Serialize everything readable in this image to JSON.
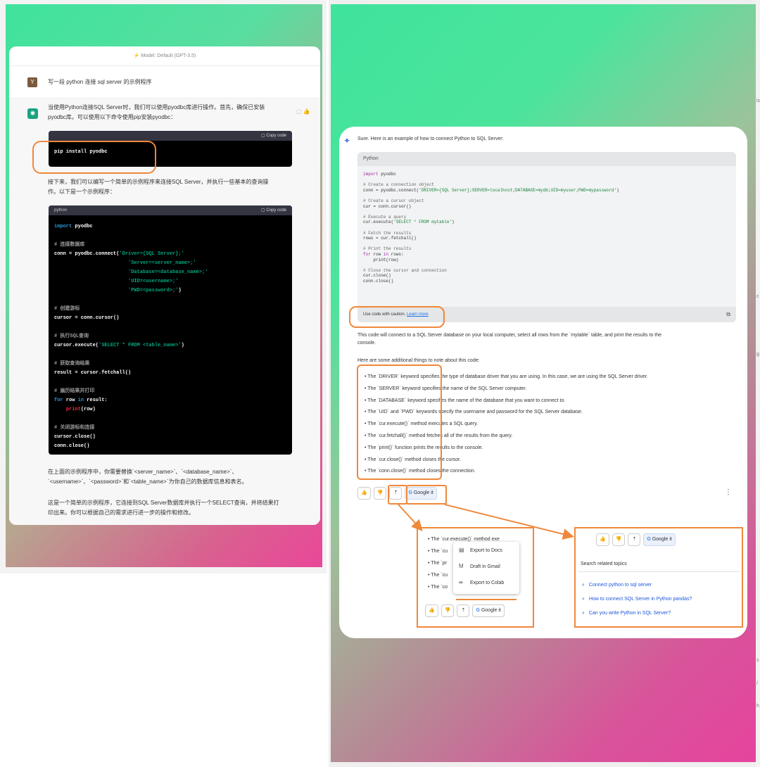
{
  "left": {
    "model_label": "⚡ Model: Default (GPT-3.5)",
    "user_avatar": "Y",
    "user_message": "写一段 python 连接 sql server 的示例程序",
    "assistant_p1_line1": "当使用Python连接SQL Server时，我们可以使用pyodbc库进行操作。首先，确保已安装",
    "assistant_p1_line2": "pyodbc库。可以使用以下命令使用pip安装pyodbc：",
    "copy_label": "Copy code",
    "code1_lang": "",
    "code1": "pip install pyodbc",
    "assistant_p2_line1": "接下来，我们可以编写一个简单的示例程序来连接SQL Server，并执行一些基本的查询操",
    "assistant_p2_line2": "作。以下是一个示例程序：",
    "code2_lang": "python",
    "code2_lines": {
      "l1_kw": "import",
      "l1_rest": " pyodbc",
      "l2": "# 连接数据库",
      "l3_a": "conn = pyodbc.connect(",
      "l3_s": "'Driver={SQL Server};'",
      "l4": "'Server=<server_name>;'",
      "l5": "'Database=<database_name>;'",
      "l6": "'UID=<username>;'",
      "l7_s": "'PWD=<password>;'",
      "l7_e": ")",
      "l8": "# 创建游标",
      "l9": "cursor = conn.cursor()",
      "l10": "# 执行SQL查询",
      "l11_a": "cursor.execute(",
      "l11_s": "'SELECT * FROM <table_name>'",
      "l11_e": ")",
      "l12": "# 获取查询结果",
      "l13": "result = cursor.fetchall()",
      "l14": "# 遍历结果并打印",
      "l15_k1": "for",
      "l15_a": " row ",
      "l15_k2": "in",
      "l15_b": " result:",
      "l16_f": "print",
      "l16_e": "(row)",
      "l17": "# 关闭游标和连接",
      "l18": "cursor.close()",
      "l19": "conn.close()"
    },
    "assistant_p3_line1": "在上面的示例程序中，你需要替换`<server_name>`、`<database_name>`、",
    "assistant_p3_line2": "`<username>`、`<password>`和`<table_name>`为你自己的数据库信息和表名。",
    "assistant_p4_line1": "这是一个简单的示例程序，它连接到SQL Server数据库并执行一个SELECT查询，并将结果打",
    "assistant_p4_line2": "印出来。你可以根据自己的需求进行进一步的操作和修改。"
  },
  "right": {
    "intro": "Sure. Here is an example of how to connect Python to SQL Server:",
    "code_lang": "Python",
    "code": {
      "c1_kw": "import",
      "c1_rest": " pyodbc",
      "c2": "# Create a connection object",
      "c3_a": "conn = pyodbc.connect(",
      "c3_s": "'DRIVER={SQL Server};SERVER=localhost;DATABASE=mydb;UID=myuser;PWD=mypassword'",
      "c3_e": ")",
      "c4": "# Create a cursor object",
      "c5": "cur = conn.cursor()",
      "c6": "# Execute a query",
      "c7_a": "cur.execute(",
      "c7_s": "'SELECT * FROM mytable'",
      "c7_e": ")",
      "c8": "# Fetch the results",
      "c9": "rows = cur.fetchall()",
      "c10": "# Print the results",
      "c11_k1": "for",
      "c11_a": " row ",
      "c11_k2": "in",
      "c11_b": " rows:",
      "c12": "    print(row)",
      "c13": "# Close the cursor and connection",
      "c14": "cur.close()",
      "c15": "conn.close()"
    },
    "caution_text": "Use code with caution. ",
    "learn_more": "Learn more",
    "summary_line1": "This code will connect to a SQL Server database on your local computer, select all rows from the `mytable` table, and print the results to the",
    "summary_line2": "console.",
    "notes_heading": "Here are some additional things to note about this code:",
    "bullets": [
      "The `DRIVER` keyword specifies the type of database driver that you are using. In this case, we are using the SQL Server driver.",
      "The `SERVER` keyword specifies the name of the SQL Server computer.",
      "The `DATABASE` keyword specifies the name of the database that you want to connect to.",
      "The `UID` and `PWD` keywords specify the username and password for the SQL Server database.",
      "The `cur.execute()` method executes a SQL query.",
      "The `cur.fetchall()` method fetches all of the results from the query.",
      "The `print()` function prints the results to the console.",
      "The `cur.close()` method closes the cursor.",
      "The `conn.close()` method closes the connection."
    ],
    "google_it": "Google it",
    "zoom_left_bullets": [
      "The `cur.execute()` method exe",
      "The `cu",
      "The `pr",
      "The `cu",
      "The `co"
    ],
    "zoom_left_tails": [
      "fe",
      "e r",
      "ses",
      "ose"
    ],
    "menu_items": [
      "Export to Docs",
      "Draft in Gmail",
      "Export to Colab"
    ],
    "search_related": "Search related topics",
    "related": [
      "Connect python to sql server",
      "How to connect SQL Server in Python pandas?",
      "Can you write Python in SQL Server?"
    ],
    "icons": {
      "thumbs_up": "👍",
      "thumbs_down": "👎",
      "share": "⇡",
      "more": "⋮",
      "search": "🔍"
    }
  },
  "edge": {
    "chars": [
      "is",
      "c",
      "g",
      "s",
      "/",
      "h"
    ]
  }
}
